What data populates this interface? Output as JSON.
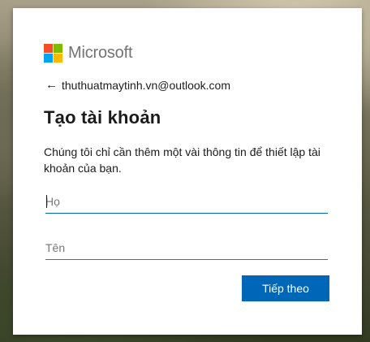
{
  "brand": {
    "name": "Microsoft",
    "logo_colors": [
      "#f25022",
      "#7fba00",
      "#00a4ef",
      "#ffb900"
    ]
  },
  "identity": {
    "back_icon": "arrow-left-icon",
    "email": "thuthuatmaytinh.vn@outlook.com"
  },
  "page": {
    "title": "Tạo tài khoản",
    "description": "Chúng tôi chỉ cần thêm một vài thông tin để thiết lập tài khoản của bạn."
  },
  "form": {
    "last_name": {
      "placeholder": "Họ",
      "value": ""
    },
    "first_name": {
      "placeholder": "Tên",
      "value": ""
    }
  },
  "actions": {
    "next_label": "Tiếp theo"
  },
  "colors": {
    "accent": "#0067b8"
  }
}
